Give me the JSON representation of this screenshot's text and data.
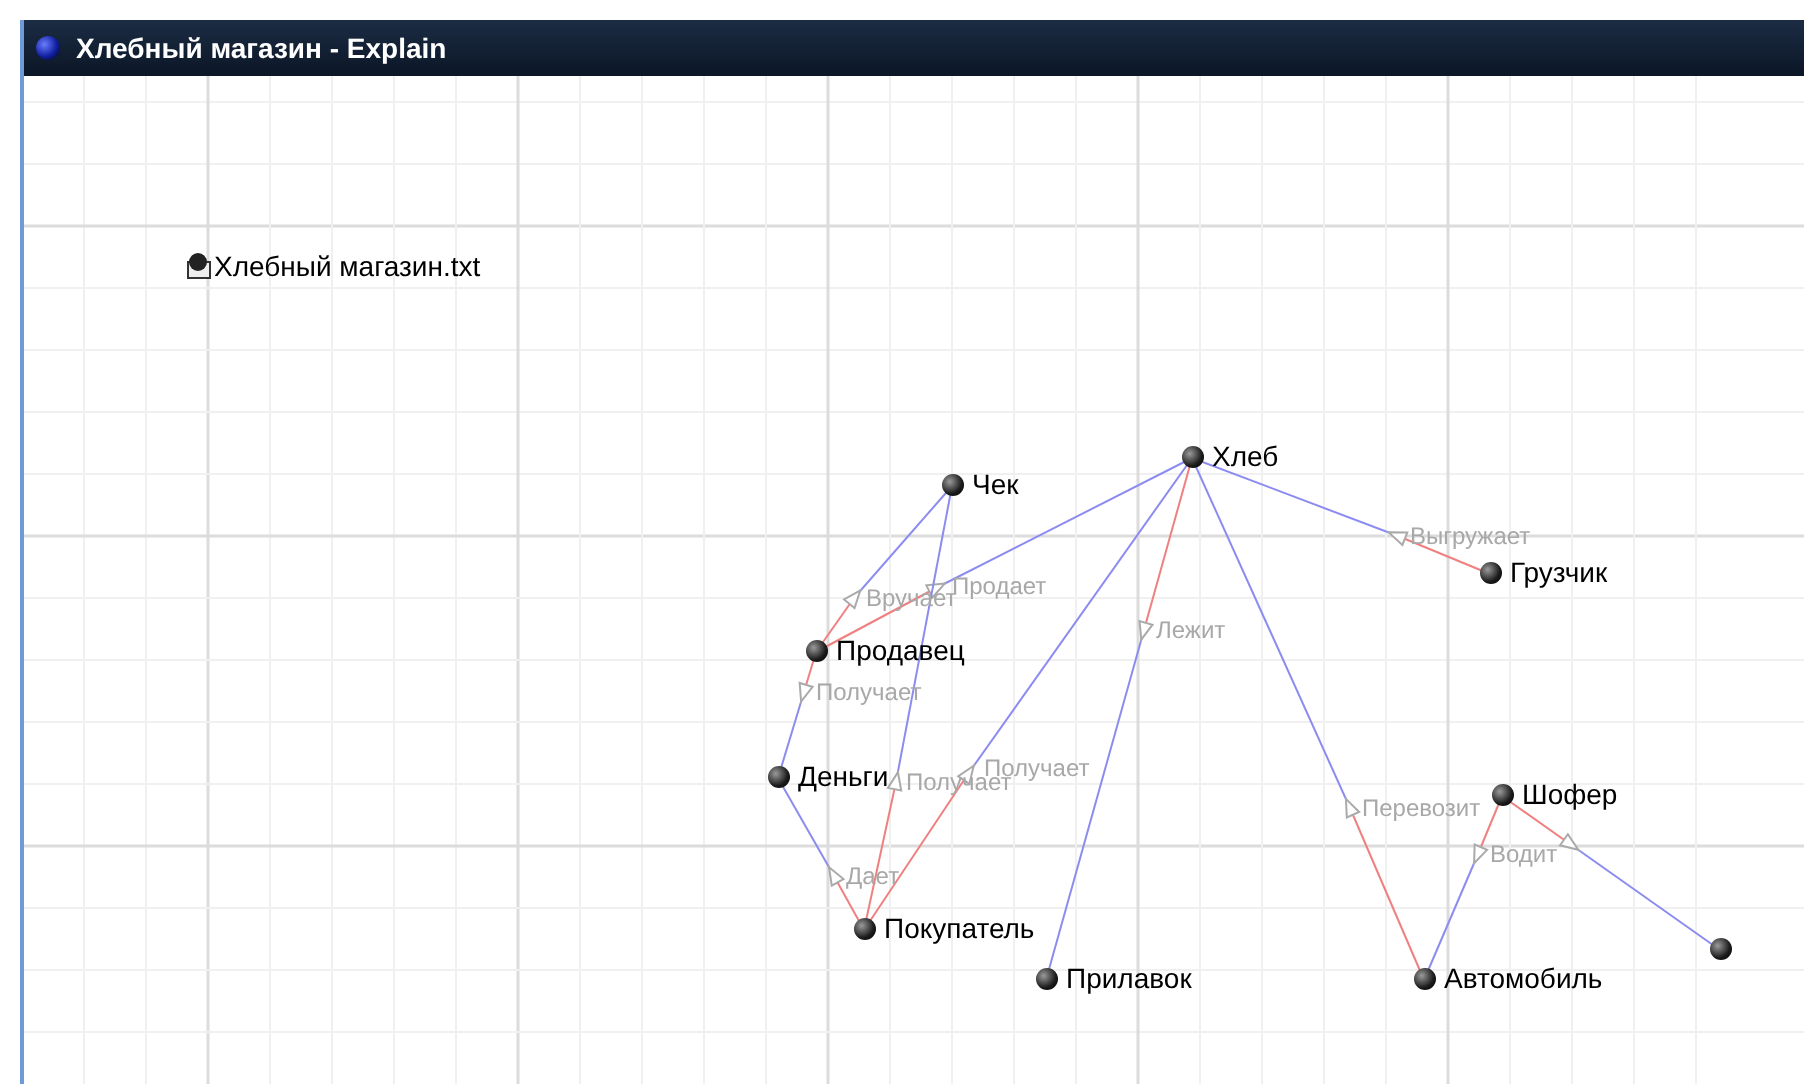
{
  "window": {
    "title": "Хлебный магазин - Explain"
  },
  "file_node": {
    "label": "Хлебный магазин.txt"
  },
  "nodes": [
    {
      "label": "Хлеб"
    },
    {
      "label": "Чек"
    },
    {
      "label": "Продавец"
    },
    {
      "label": "Деньги"
    },
    {
      "label": "Покупатель"
    },
    {
      "label": "Прилавок"
    },
    {
      "label": "Грузчик"
    },
    {
      "label": "Шофер"
    },
    {
      "label": "Автомобиль"
    }
  ],
  "edges": [
    {
      "label": "Выгружает"
    },
    {
      "label": "Продает"
    },
    {
      "label": "Вручает"
    },
    {
      "label": "Получает"
    },
    {
      "label": "Получает"
    },
    {
      "label": "Получает"
    },
    {
      "label": "Дает"
    },
    {
      "label": "Лежит"
    },
    {
      "label": "Перевозит"
    },
    {
      "label": "Водит"
    }
  ]
}
